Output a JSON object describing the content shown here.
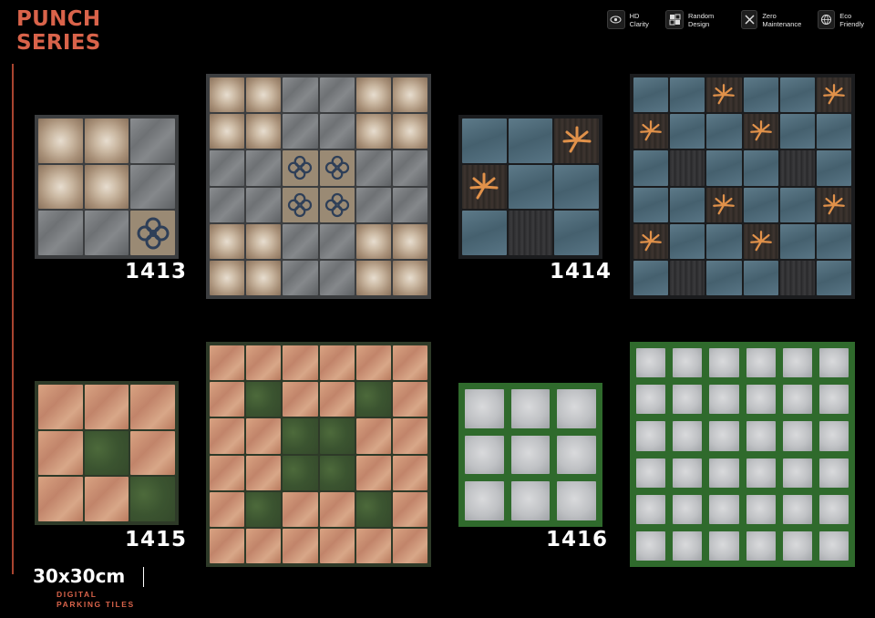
{
  "title": {
    "line1": "PUNCH",
    "line2": "SERIES"
  },
  "features": [
    {
      "icon": "hd-eye-icon",
      "text": "HD Clarity"
    },
    {
      "icon": "random-squares-icon",
      "text": "Random Design"
    },
    {
      "icon": "tools-icon",
      "text": "Zero Maintenance"
    },
    {
      "icon": "eco-globe-icon",
      "text": "Eco Friendly"
    }
  ],
  "products": [
    {
      "code": "1413"
    },
    {
      "code": "1414"
    },
    {
      "code": "1415"
    },
    {
      "code": "1416"
    }
  ],
  "size": "30x30cm",
  "subtitle": {
    "line1": "DIGITAL",
    "line2": "PARKING TILES"
  },
  "colors": {
    "accent": "#d9634a",
    "background": "#000000"
  }
}
